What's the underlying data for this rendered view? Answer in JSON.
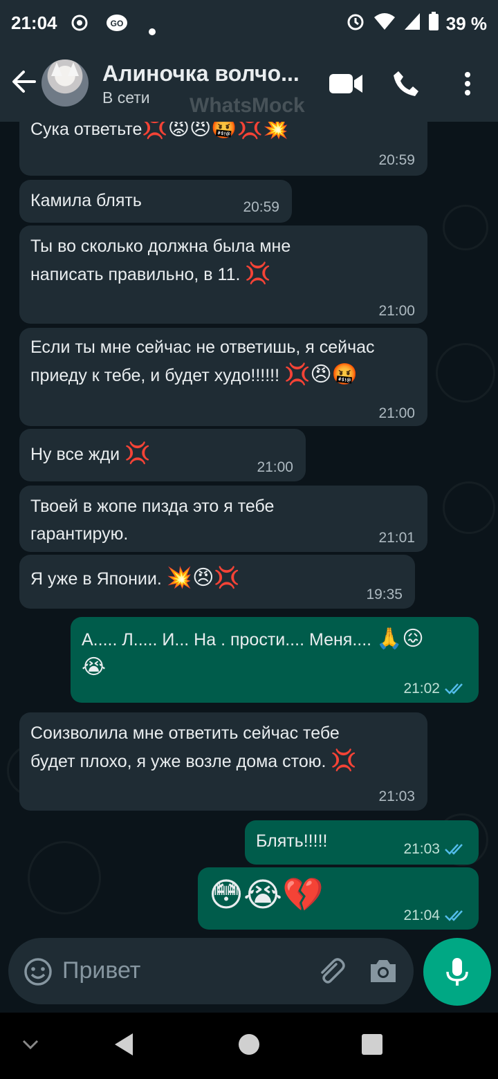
{
  "status_bar": {
    "time": "21:04",
    "battery": "39 %"
  },
  "header": {
    "contact_name": "Алиночка волчо...",
    "status": "В сети",
    "watermark": "WhatsMock"
  },
  "messages": [
    {
      "dir": "in",
      "text": "Сука ответьте",
      "emoji": "💢😡😠🤬💢💥",
      "time": "20:59"
    },
    {
      "dir": "in",
      "text": "Камила блять",
      "emoji": "",
      "time": "20:59"
    },
    {
      "dir": "in",
      "text": "Ты во сколько должна была мне\nнаписать правильно, в 11.",
      "emoji": "💢",
      "time": "21:00"
    },
    {
      "dir": "in",
      "text": "Если ты мне сейчас не ответишь, я сейчас\nприеду к тебе, и будет худо!!!!!!",
      "emoji": "💢😠🤬",
      "time": "21:00"
    },
    {
      "dir": "in",
      "text": "Ну все жди",
      "emoji": "💢",
      "time": "21:00"
    },
    {
      "dir": "in",
      "text": "Твоей в жопе пизда это я тебе\nгарантирую.",
      "emoji": "",
      "time": "21:01"
    },
    {
      "dir": "in",
      "text": "Я уже в Японии.",
      "emoji": "💥😠💢",
      "time": "19:35"
    },
    {
      "dir": "out",
      "text": "А..... Л..... И... На . прости.... Меня....",
      "emoji": "🙏😖",
      "emoji2": "😭",
      "time": "21:02"
    },
    {
      "dir": "in",
      "text": "Соизволила мне ответить сейчас тебе\nбудет плохо, я уже возле дома стою.",
      "emoji": "💢",
      "time": "21:03"
    },
    {
      "dir": "out",
      "text": "Блять!!!!!",
      "emoji": "",
      "time": "21:03"
    },
    {
      "dir": "out",
      "text": "",
      "emoji": "😳😭💔",
      "time": "21:04"
    }
  ],
  "input": {
    "placeholder": "Привет"
  },
  "icons": {
    "back": "arrow-left-icon",
    "video": "video-call-icon",
    "call": "phone-icon",
    "menu": "more-vert-icon",
    "emoji": "smile-icon",
    "attach": "paperclip-icon",
    "camera": "camera-icon",
    "mic": "mic-icon",
    "read": "double-check-icon"
  },
  "colors": {
    "background": "#0b141a",
    "header": "#1f2c34",
    "incoming": "#1f2c34",
    "outgoing": "#005c4b",
    "accent": "#00a884",
    "read_ticks": "#53bdeb"
  }
}
